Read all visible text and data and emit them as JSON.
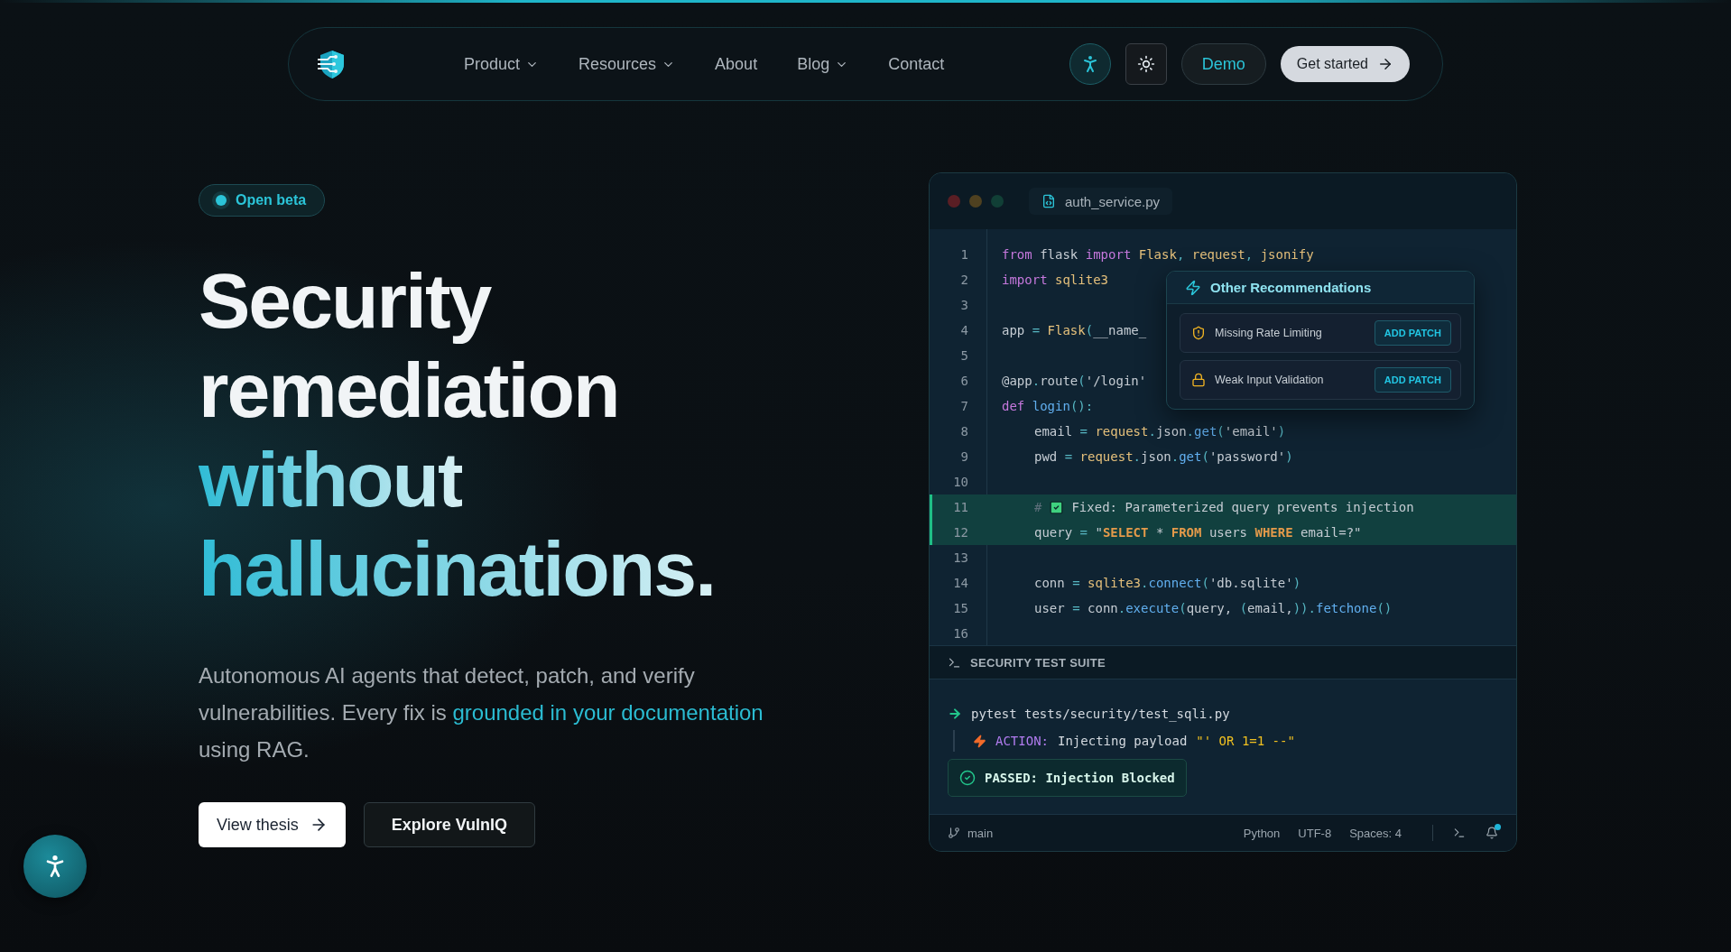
{
  "nav": {
    "links": [
      {
        "label": "Product",
        "has_dropdown": true
      },
      {
        "label": "Resources",
        "has_dropdown": true
      },
      {
        "label": "About",
        "has_dropdown": false
      },
      {
        "label": "Blog",
        "has_dropdown": true
      },
      {
        "label": "Contact",
        "has_dropdown": false
      }
    ],
    "demo": "Demo",
    "get_started": "Get started"
  },
  "hero": {
    "badge": "Open beta",
    "headline": [
      {
        "text": "Security",
        "accent": false
      },
      {
        "text": "remediation",
        "accent": false
      },
      {
        "text": "without",
        "accent": true
      },
      {
        "text": "hallucinations.",
        "accent": true
      }
    ],
    "description": {
      "before": "Autonomous AI agents that detect, patch, and verify vulnerabilities. Every fix is ",
      "highlight": "grounded in your documentation",
      "after": " using RAG."
    },
    "buttons": [
      {
        "label": "View thesis",
        "kind": "primary"
      },
      {
        "label": "Explore VulnIQ",
        "kind": "secondary"
      }
    ]
  },
  "editor": {
    "tab": "auth_service.py",
    "lines": [
      {
        "number": "1",
        "indented": false,
        "highlighted": false,
        "tokens": [
          {
            "kind": "keyword",
            "text": "from"
          },
          {
            "kind": "plain",
            "text": " flask "
          },
          {
            "kind": "keyword",
            "text": "import"
          },
          {
            "kind": "name",
            "text": " Flask"
          },
          {
            "kind": "punct",
            "text": ","
          },
          {
            "kind": "name",
            "text": " request"
          },
          {
            "kind": "punct",
            "text": ","
          },
          {
            "kind": "name",
            "text": " jsonify"
          }
        ]
      },
      {
        "number": "2",
        "indented": false,
        "highlighted": false,
        "tokens": [
          {
            "kind": "keyword",
            "text": "import"
          },
          {
            "kind": "name",
            "text": " sqlite3"
          }
        ]
      },
      {
        "number": "3",
        "highlighted": false
      },
      {
        "number": "4",
        "indented": false,
        "highlighted": false,
        "tokens": [
          {
            "kind": "plain",
            "text": "app "
          },
          {
            "kind": "punct",
            "text": "="
          },
          {
            "kind": "name",
            "text": " Flask"
          },
          {
            "kind": "punct",
            "text": "("
          },
          {
            "kind": "plain",
            "text": "__name_"
          }
        ]
      },
      {
        "number": "5",
        "highlighted": false
      },
      {
        "number": "6",
        "indented": false,
        "highlighted": false,
        "tokens": [
          {
            "kind": "plain",
            "text": "@app"
          },
          {
            "kind": "punct",
            "text": "."
          },
          {
            "kind": "plain",
            "text": "route"
          },
          {
            "kind": "punct",
            "text": "("
          },
          {
            "kind": "string",
            "text": "'/login'"
          }
        ]
      },
      {
        "number": "7",
        "indented": false,
        "highlighted": false,
        "tokens": [
          {
            "kind": "keyword",
            "text": "def"
          },
          {
            "kind": "method",
            "text": " login"
          },
          {
            "kind": "punct",
            "text": "():"
          }
        ]
      },
      {
        "number": "8",
        "indented": true,
        "highlighted": false,
        "tokens": [
          {
            "kind": "plain",
            "text": "email "
          },
          {
            "kind": "punct",
            "text": "="
          },
          {
            "kind": "name",
            "text": " request"
          },
          {
            "kind": "punct",
            "text": "."
          },
          {
            "kind": "plain",
            "text": "json"
          },
          {
            "kind": "punct",
            "text": "."
          },
          {
            "kind": "method",
            "text": "get"
          },
          {
            "kind": "punct",
            "text": "("
          },
          {
            "kind": "string",
            "text": "'email'"
          },
          {
            "kind": "punct",
            "text": ")"
          }
        ]
      },
      {
        "number": "9",
        "indented": true,
        "highlighted": false,
        "tokens": [
          {
            "kind": "plain",
            "text": "pwd "
          },
          {
            "kind": "punct",
            "text": "="
          },
          {
            "kind": "name",
            "text": " request"
          },
          {
            "kind": "punct",
            "text": "."
          },
          {
            "kind": "plain",
            "text": "json"
          },
          {
            "kind": "punct",
            "text": "."
          },
          {
            "kind": "method",
            "text": "get"
          },
          {
            "kind": "punct",
            "text": "("
          },
          {
            "kind": "string",
            "text": "'password'"
          },
          {
            "kind": "punct",
            "text": ")"
          }
        ]
      },
      {
        "number": "10",
        "highlighted": false
      },
      {
        "number": "11",
        "indented": true,
        "highlighted": true,
        "tokens": [
          {
            "kind": "comment",
            "text": "#"
          },
          {
            "kind": "check"
          },
          {
            "kind": "plain",
            "text": "Fixed: Parameterized query prevents injection"
          }
        ]
      },
      {
        "number": "12",
        "indented": true,
        "highlighted": true,
        "tokens": [
          {
            "kind": "plain",
            "text": "query "
          },
          {
            "kind": "punct",
            "text": "="
          },
          {
            "kind": "string",
            "text": " \""
          },
          {
            "kind": "sql",
            "text": "SELECT"
          },
          {
            "kind": "string",
            "text": " * "
          },
          {
            "kind": "sql",
            "text": "FROM"
          },
          {
            "kind": "string",
            "text": " users "
          },
          {
            "kind": "sql",
            "text": "WHERE"
          },
          {
            "kind": "string",
            "text": " email=?\""
          }
        ]
      },
      {
        "number": "13",
        "highlighted": false
      },
      {
        "number": "14",
        "indented": true,
        "highlighted": false,
        "tokens": [
          {
            "kind": "plain",
            "text": "conn "
          },
          {
            "kind": "punct",
            "text": "="
          },
          {
            "kind": "name",
            "text": " sqlite3"
          },
          {
            "kind": "punct",
            "text": "."
          },
          {
            "kind": "method",
            "text": "connect"
          },
          {
            "kind": "punct",
            "text": "("
          },
          {
            "kind": "string",
            "text": "'db.sqlite'"
          },
          {
            "kind": "punct",
            "text": ")"
          }
        ]
      },
      {
        "number": "15",
        "indented": true,
        "highlighted": false,
        "tokens": [
          {
            "kind": "plain",
            "text": "user "
          },
          {
            "kind": "punct",
            "text": "="
          },
          {
            "kind": "plain",
            "text": " conn"
          },
          {
            "kind": "punct",
            "text": "."
          },
          {
            "kind": "method",
            "text": "execute"
          },
          {
            "kind": "punct",
            "text": "("
          },
          {
            "kind": "plain",
            "text": "query, "
          },
          {
            "kind": "punct",
            "text": "("
          },
          {
            "kind": "plain",
            "text": "email,"
          },
          {
            "kind": "punct",
            "text": "))."
          },
          {
            "kind": "method",
            "text": "fetchone"
          },
          {
            "kind": "punct",
            "text": "()"
          }
        ]
      },
      {
        "number": "16",
        "highlighted": false
      }
    ],
    "recommendations": {
      "title": "Other Recommendations",
      "items": [
        {
          "kind": "shield",
          "label": "Missing Rate Limiting",
          "action": "ADD PATCH"
        },
        {
          "kind": "lock",
          "label": "Weak Input Validation",
          "action": "ADD PATCH"
        }
      ]
    },
    "terminal": {
      "title": "SECURITY TEST SUITE",
      "command": "pytest tests/security/test_sqli.py",
      "action_label": "ACTION:",
      "action_text": "Injecting payload",
      "payload": "\"' OR 1=1 --\"",
      "result": "PASSED: Injection Blocked"
    },
    "status_bar": {
      "branch": "main",
      "items": [
        "Python",
        "UTF-8",
        "Spaces: 4"
      ],
      "notification": true
    }
  }
}
